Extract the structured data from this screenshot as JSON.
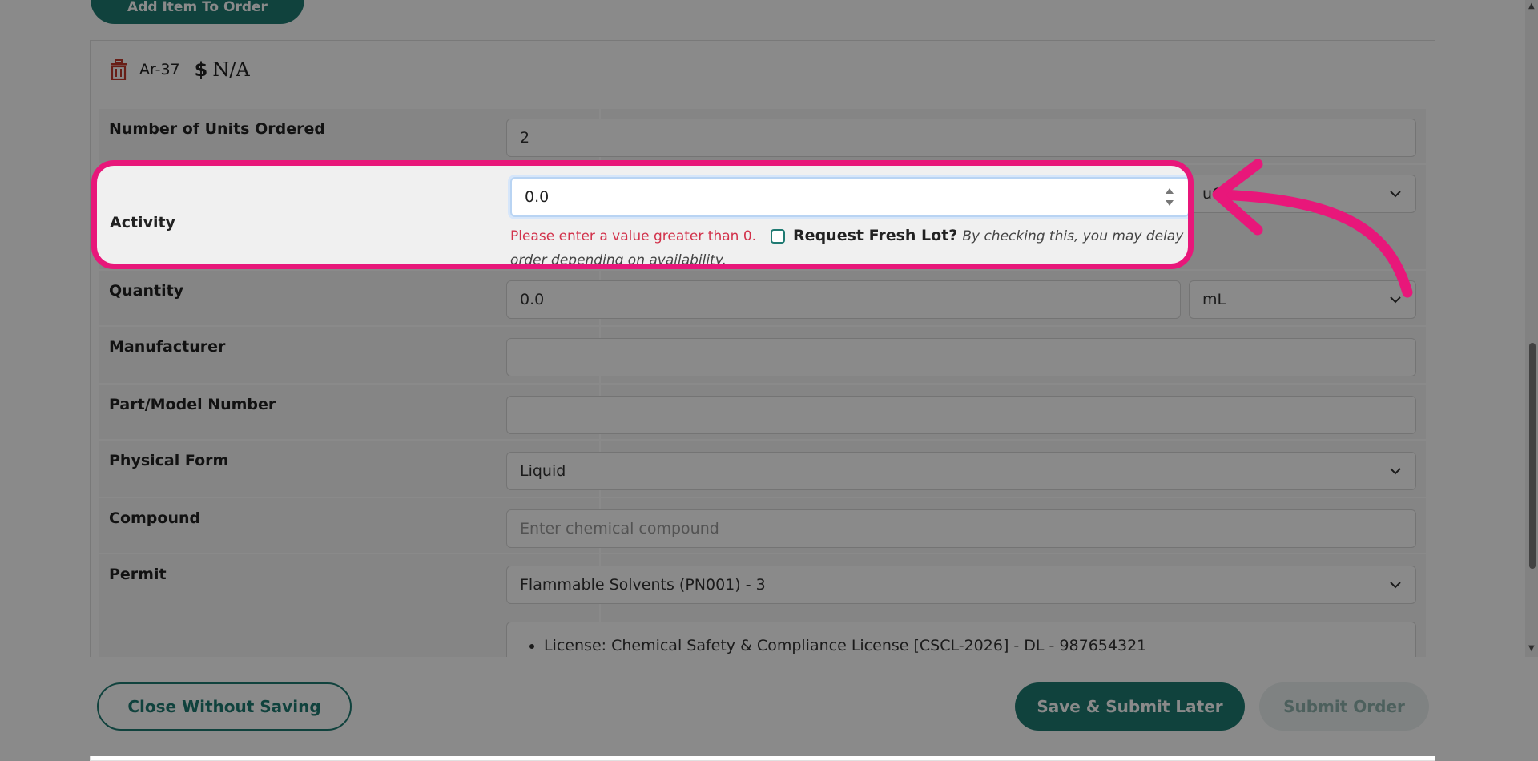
{
  "top_button": {
    "label": "Add Item To Order"
  },
  "item": {
    "code": "Ar-37",
    "price": "N/A",
    "currency_symbol": "$"
  },
  "rows": {
    "units": {
      "label": "Number of Units Ordered",
      "value": "2"
    },
    "activity": {
      "label": "Activity",
      "value": "0.0",
      "unit": "uCi",
      "error": "Please enter a value greater than 0.",
      "fresh_lot_label": "Request Fresh Lot?",
      "fresh_lot_note": "By checking this, you may delay this order depending on availability."
    },
    "quantity": {
      "label": "Quantity",
      "value": "0.0",
      "unit": "mL"
    },
    "manufacturer": {
      "label": "Manufacturer",
      "value": ""
    },
    "part_number": {
      "label": "Part/Model Number",
      "value": ""
    },
    "physical_form": {
      "label": "Physical Form",
      "value": "Liquid"
    },
    "compound": {
      "label": "Compound",
      "placeholder": "Enter chemical compound"
    },
    "permit": {
      "label": "Permit",
      "value": "Flammable Solvents (PN001) - 3",
      "license": "License: Chemical Safety & Compliance License [CSCL-2026] - DL - 987654321"
    }
  },
  "footer": {
    "close_label": "Close Without Saving",
    "save_label": "Save & Submit Later",
    "submit_label": "Submit Order"
  },
  "colors": {
    "accent": "#1f7a72",
    "highlight": "#e8177a",
    "error": "#d2324b"
  }
}
